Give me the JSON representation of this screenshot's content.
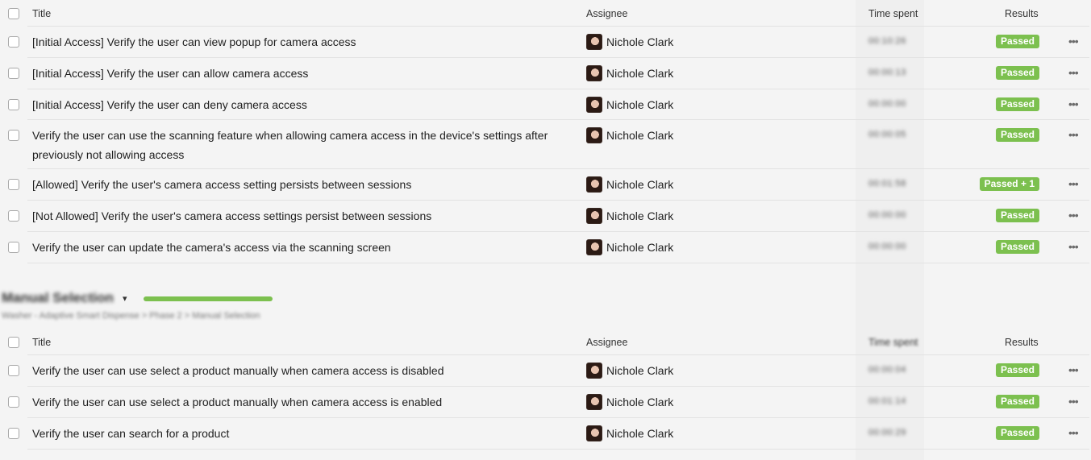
{
  "table1": {
    "headers": {
      "title": "Title",
      "assignee": "Assignee",
      "time": "Time spent",
      "results": "Results"
    },
    "rows": [
      {
        "title": "[Initial Access] Verify the user can view popup for camera access",
        "assignee": "Nichole Clark",
        "time": "00:10:26",
        "result": "Passed"
      },
      {
        "title": "[Initial Access] Verify the user can allow camera access",
        "assignee": "Nichole Clark",
        "time": "00:00:13",
        "result": "Passed"
      },
      {
        "title": "[Initial Access] Verify the user can deny camera access",
        "assignee": "Nichole Clark",
        "time": "00:00:00",
        "result": "Passed"
      },
      {
        "title": "Verify the user can use the scanning feature when allowing camera access in the device's settings after previously not allowing access",
        "assignee": "Nichole Clark",
        "time": "00:00:05",
        "result": "Passed"
      },
      {
        "title": "[Allowed] Verify the user's camera access setting persists between sessions",
        "assignee": "Nichole Clark",
        "time": "00:01:58",
        "result": "Passed + 1"
      },
      {
        "title": "[Not Allowed] Verify the user's camera access settings persist between sessions",
        "assignee": "Nichole Clark",
        "time": "00:00:00",
        "result": "Passed"
      },
      {
        "title": "Verify the user can update the camera's access via the scanning screen",
        "assignee": "Nichole Clark",
        "time": "00:00:00",
        "result": "Passed"
      }
    ]
  },
  "section": {
    "title": "Manual Selection",
    "progress": 1.0,
    "breadcrumb": "Washer - Adaptive Smart Dispense > Phase 2 > Manual Selection",
    "progress_color": "#7cc04f"
  },
  "table2": {
    "headers": {
      "title": "Title",
      "assignee": "Assignee",
      "time": "Time spent",
      "results": "Results"
    },
    "rows": [
      {
        "title": "Verify the user can use select a product manually when camera access is disabled",
        "assignee": "Nichole Clark",
        "time": "00:00:04",
        "result": "Passed"
      },
      {
        "title": "Verify the user can use select a product manually when camera access is enabled",
        "assignee": "Nichole Clark",
        "time": "00:01:14",
        "result": "Passed"
      },
      {
        "title": "Verify the user can search for a product",
        "assignee": "Nichole Clark",
        "time": "00:00:29",
        "result": "Passed"
      }
    ]
  },
  "icons": {
    "more": "more-horizontal-icon",
    "chevron": "chevron-down-icon",
    "avatar": "user-avatar"
  },
  "colors": {
    "passed": "#7cc04f",
    "background": "#f4f4f4"
  }
}
